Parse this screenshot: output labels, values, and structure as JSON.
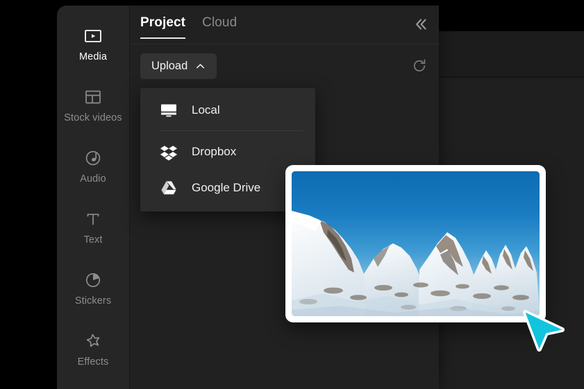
{
  "app": {
    "name": "video-editor"
  },
  "sidebar": {
    "items": [
      {
        "label": "Media",
        "icon": "media-play-frame-icon",
        "active": true
      },
      {
        "label": "Stock videos",
        "icon": "stock-videos-layout-icon",
        "active": false
      },
      {
        "label": "Audio",
        "icon": "audio-note-icon",
        "active": false
      },
      {
        "label": "Text",
        "icon": "text-t-icon",
        "active": false
      },
      {
        "label": "Stickers",
        "icon": "stickers-circle-icon",
        "active": false
      },
      {
        "label": "Effects",
        "icon": "effects-sparkle-star-icon",
        "active": false
      }
    ]
  },
  "topbar": {
    "tabs": [
      {
        "label": "Project",
        "active": true
      },
      {
        "label": "Cloud",
        "active": false
      }
    ],
    "collapse_icon": "chevron-double-left-icon"
  },
  "toolbar": {
    "upload_label": "Upload",
    "upload_caret_icon": "chevron-up-icon",
    "refresh_icon": "refresh-icon"
  },
  "upload_menu": {
    "open": true,
    "items": [
      {
        "label": "Local",
        "icon": "monitor-icon"
      },
      {
        "label": "Dropbox",
        "icon": "dropbox-icon"
      },
      {
        "label": "Google Drive",
        "icon": "google-drive-icon"
      }
    ]
  },
  "media_card": {
    "alt": "snow-covered mountain peaks under clear blue sky"
  },
  "cursor": {
    "icon": "arrow-pointer-cursor",
    "fill": "#12c4de",
    "stroke": "#ffffff"
  },
  "colors": {
    "backdrop": "#000000",
    "panel": "#212121",
    "sidebar": "#262626",
    "menu": "#2c2c2c",
    "button": "#333333",
    "text_active": "#ffffff",
    "text_muted": "#8d8d8d",
    "accent_cursor": "#12c4de"
  }
}
